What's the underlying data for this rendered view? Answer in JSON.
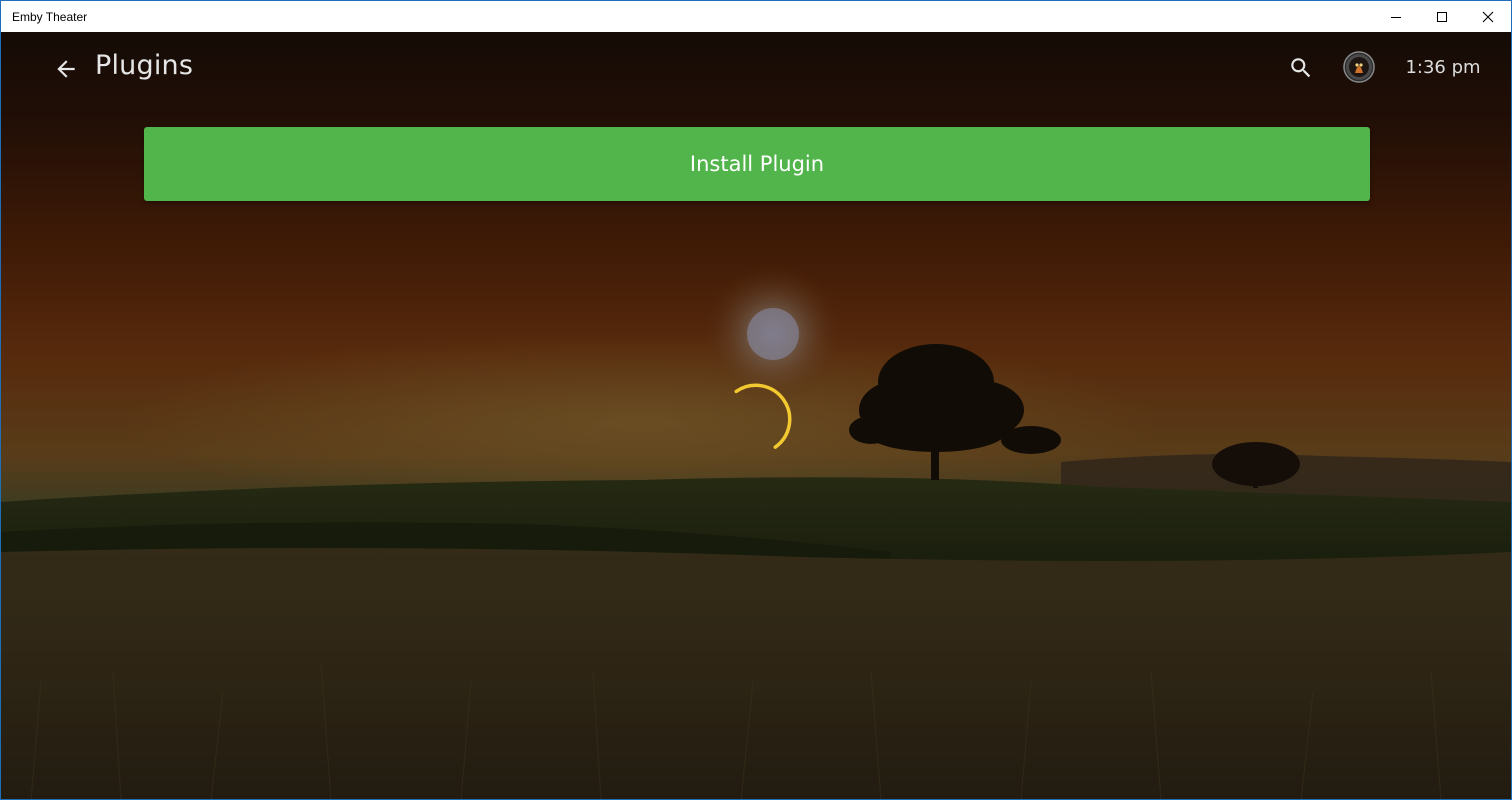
{
  "window": {
    "title": "Emby Theater",
    "controls": {
      "minimize_icon": "minimize-icon",
      "maximize_icon": "maximize-icon",
      "close_icon": "close-icon"
    }
  },
  "header": {
    "back_icon": "back-arrow-icon",
    "title": "Plugins",
    "search_icon": "search-icon",
    "avatar_icon": "user-avatar",
    "time": "1:36 pm"
  },
  "main": {
    "install_button_label": "Install Plugin",
    "loading_indicator": "loading-spinner-icon"
  },
  "colors": {
    "accent_green": "#52b54b",
    "spinner_yellow": "#f2c930",
    "header_text": "#e6e6e6"
  }
}
